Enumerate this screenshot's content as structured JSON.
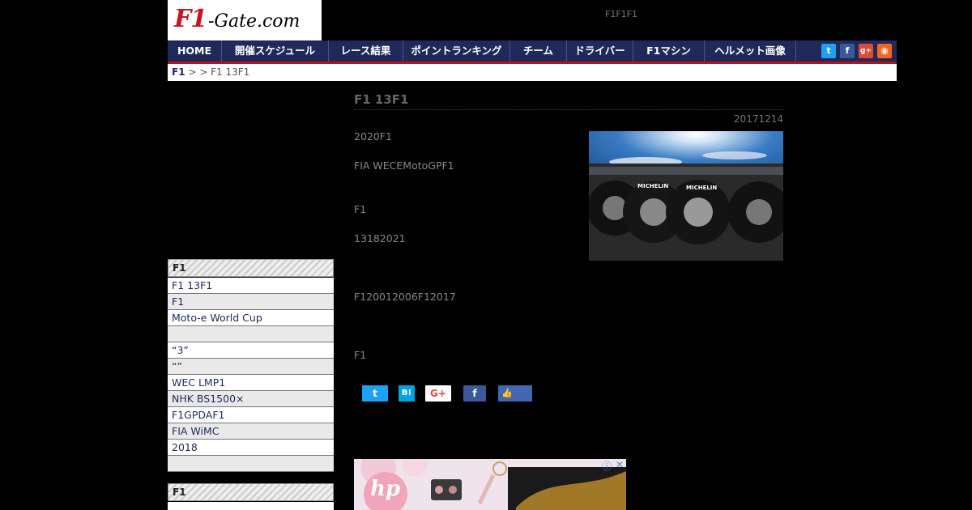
{
  "header": {
    "logo_f1": "F1",
    "logo_rest": "-Gate.com",
    "tagline": "F1F1F1"
  },
  "nav": {
    "items": [
      "HOME",
      "開催スケジュール",
      "レース結果",
      "ポイントランキング",
      "チーム",
      "ドライバー",
      "F1マシン",
      "ヘルメット画像"
    ],
    "social": [
      {
        "icon": "twitter-icon",
        "glyph": "t",
        "color": "#1da1f2"
      },
      {
        "icon": "facebook-icon",
        "glyph": "f",
        "color": "#3b5998"
      },
      {
        "icon": "google-plus-icon",
        "glyph": "g+",
        "color": "#dd4b39"
      },
      {
        "icon": "rss-icon",
        "glyph": "◉",
        "color": "#f26522"
      }
    ]
  },
  "breadcrumb": {
    "home": "F1",
    "rest": " >  > F1 13F1"
  },
  "article": {
    "title": "F1 13F1",
    "date": "20171214",
    "paragraphs": [
      "2020F1",
      "FIA WECEMotoGPF1",
      "F1",
      "13182021",
      "F120012006F12017",
      "F1"
    ]
  },
  "share": {
    "twitter": "t",
    "hatena": "B!",
    "google": "G+",
    "facebook": "f",
    "like": "👍"
  },
  "ad": {
    "brand": "hp",
    "info": "ⓘ",
    "close": "✕"
  },
  "sidebar": {
    "heading1": "F1",
    "items": [
      "F1 13F1",
      " F1",
      "Moto-e World Cup",
      "",
      " “3”",
      " “”",
      "WEC LMP1",
      "NHK BS1500×",
      "F1GPDAF1",
      "FIA WiMC",
      " 2018",
      ""
    ],
    "heading2": "F1"
  }
}
